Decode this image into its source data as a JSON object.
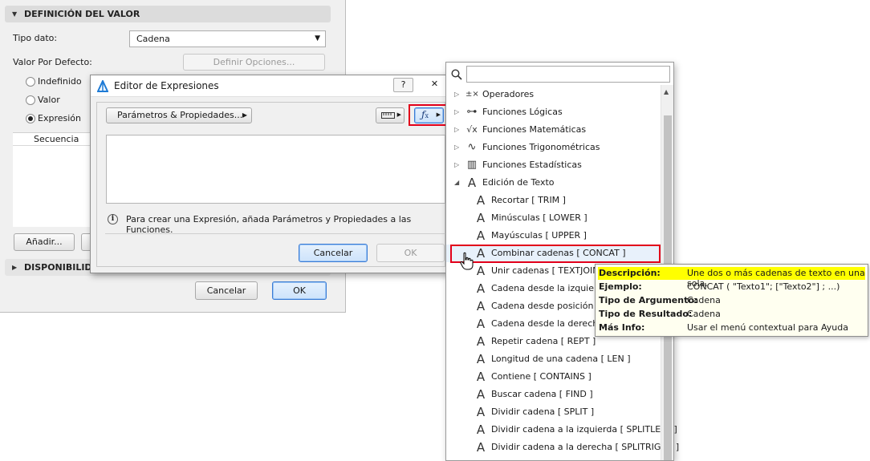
{
  "settings_panel": {
    "section_value_definition": "DEFINICIÓN DEL VALOR",
    "data_type_label": "Tipo dato:",
    "data_type_value": "Cadena",
    "default_value_label": "Valor Por Defecto:",
    "define_options_button": "Definir Opciones...",
    "radio_undefined": "Indefinido",
    "radio_value": "Valor",
    "radio_expression": "Expresión",
    "selected_radio": "Expresión",
    "sequence_header": "Secuencia",
    "add_button": "Añadir...",
    "section_availability": "DISPONIBILIDAD",
    "cancel_button": "Cancelar",
    "ok_button": "OK"
  },
  "dialog": {
    "title": "Editor de Expresiones",
    "help_button": "?",
    "close_button": "✕",
    "params_button": "Parámetros & Propiedades...",
    "info_text": "Para crear una Expresión, añada Parámetros y Propiedades a las Funciones.",
    "cancel_button": "Cancelar",
    "ok_button": "OK",
    "highlight_color": "#e2001a"
  },
  "functions_list": {
    "search_placeholder": "",
    "categories": [
      {
        "label": "Operadores",
        "icon": "operators-icon",
        "glyph": "±×"
      },
      {
        "label": "Funciones Lógicas",
        "icon": "logical-functions-icon",
        "glyph": "⊶"
      },
      {
        "label": "Funciones Matemáticas",
        "icon": "math-functions-icon",
        "glyph": "√x"
      },
      {
        "label": "Funciones Trigonométricas",
        "icon": "trig-functions-icon",
        "glyph": "∿"
      },
      {
        "label": "Funciones Estadísticas",
        "icon": "statistics-functions-icon",
        "glyph": "▥"
      },
      {
        "label": "Edición de Texto",
        "icon": "text-editing-icon",
        "glyph": "A",
        "expanded": true
      }
    ],
    "text_functions": [
      {
        "label": "Recortar [ TRIM ]"
      },
      {
        "label": "Minúsculas [ LOWER ]"
      },
      {
        "label": "Mayúsculas [ UPPER ]"
      },
      {
        "label": "Combinar cadenas [ CONCAT ]",
        "selected": true
      },
      {
        "label": "Unir cadenas [ TEXTJOIN ]"
      },
      {
        "label": "Cadena desde la izquierda"
      },
      {
        "label": "Cadena desde posición ["
      },
      {
        "label": "Cadena desde la derecha"
      },
      {
        "label": "Repetir cadena [ REPT ]"
      },
      {
        "label": "Longitud de una cadena [ LEN ]"
      },
      {
        "label": "Contiene [ CONTAINS ]"
      },
      {
        "label": "Buscar cadena [ FIND ]"
      },
      {
        "label": "Dividir cadena [ SPLIT ]"
      },
      {
        "label": "Dividir cadena a la izquierda [ SPLITLEFT ]"
      },
      {
        "label": "Dividir cadena a la derecha [ SPLITRIGHT ]"
      }
    ]
  },
  "tooltip": {
    "description_label": "Descripción:",
    "description_value": "Une dos o más cadenas de texto en una sola.",
    "example_label": "Ejemplo:",
    "example_value": "CONCAT ( \"Texto1\"; [\"Texto2\"] ; ...)",
    "argument_type_label": "Tipo de Argumento:",
    "argument_type_value": "Cadena",
    "result_type_label": "Tipo de Resultado:",
    "result_type_value": "Cadena",
    "more_info_label": "Más Info:",
    "more_info_value": "Usar el menú contextual para Ayuda"
  }
}
